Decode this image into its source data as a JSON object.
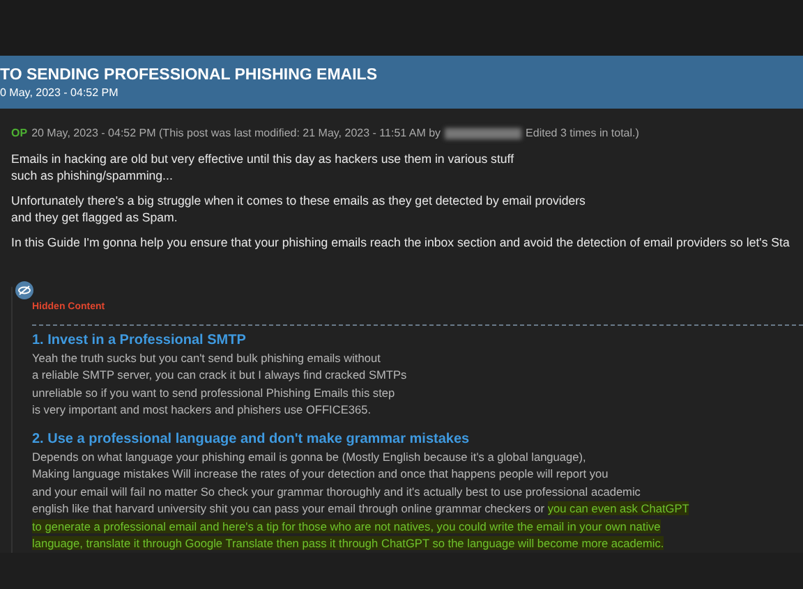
{
  "thread": {
    "title": "TO SENDING PROFESSIONAL PHISHING EMAILS",
    "date": "0 May, 2023 - 04:52 PM"
  },
  "post": {
    "badge": "OP",
    "meta_before": "20 May, 2023 - 04:52 PM (This post was last modified: 21 May, 2023 - 11:51 AM by",
    "meta_after": "Edited 3 times in total.)",
    "paragraphs": [
      [
        "Emails in hacking are old but very effective until this day as hackers use them in various stuff",
        "such as phishing/spamming..."
      ],
      [
        "Unfortunately there's a big struggle when it comes to these emails as they get detected by email providers",
        "and they get flagged as Spam."
      ],
      [
        "In this Guide I'm gonna help you ensure that your phishing emails reach the inbox section and avoid the detection of email providers so let's Sta"
      ]
    ]
  },
  "hidden": {
    "label": "Hidden Content",
    "sections": [
      {
        "heading": "1. Invest in a Professional SMTP",
        "lines": [
          [
            {
              "text": "Yeah the truth sucks but you can't send bulk phishing emails without",
              "highlighted": false
            }
          ],
          [
            {
              "text": "a reliable SMTP server, you can crack it but I always find cracked SMTPs",
              "highlighted": false
            }
          ],
          [
            {
              "text": "unreliable so if you want to send professional Phishing Emails this step",
              "highlighted": false
            }
          ],
          [
            {
              "text": "is very important and most hackers and phishers use OFFICE365.",
              "highlighted": false
            }
          ]
        ]
      },
      {
        "heading": "2. Use a professional language and don't make grammar mistakes",
        "lines": [
          [
            {
              "text": "Depends on what language your phishing email is gonna be (Mostly English because it's a global language),",
              "highlighted": false
            }
          ],
          [
            {
              "text": "Making language mistakes Will increase the rates of your detection and once that happens people will report you",
              "highlighted": false
            }
          ],
          [
            {
              "text": "and your email will fail no matter So check your grammar thoroughly and it's actually best to use professional academic",
              "highlighted": false
            }
          ],
          [
            {
              "text": "english like that harvard university shit you can pass your email through online grammar checkers or",
              "highlighted": false
            },
            {
              "text": "you can even ask ChatGPT",
              "highlighted": true
            }
          ],
          [
            {
              "text": "to generate a professional email and here's a tip for those who are not natives, you could write the email in your own native",
              "highlighted": true
            }
          ],
          [
            {
              "text": "language, translate it through Google Translate then pass it through ChatGPT so the language will become more academic.",
              "highlighted": true
            }
          ]
        ]
      }
    ]
  }
}
